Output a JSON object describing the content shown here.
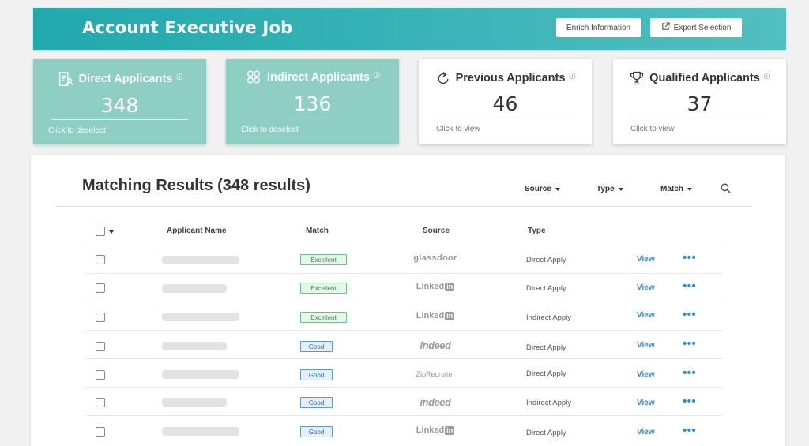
{
  "header": {
    "title": "Account Executive Job",
    "enrich_label": "Enrich Information",
    "export_label": "Export Selection"
  },
  "stats": [
    {
      "label": "Direct Applicants",
      "value": "348",
      "sub": "Click to deselect",
      "icon": "resume-icon",
      "style": "selected"
    },
    {
      "label": "Indirect Applicants",
      "value": "136",
      "sub": "Click to deselect",
      "icon": "group-icon",
      "style": "selected"
    },
    {
      "label": "Previous Applicants",
      "value": "46",
      "sub": "Click to view",
      "icon": "refresh-icon",
      "style": "default"
    },
    {
      "label": "Qualified Applicants",
      "value": "37",
      "sub": "Click to view",
      "icon": "trophy-icon",
      "style": "default"
    }
  ],
  "info_glyph": "ⓘ",
  "results": {
    "title": "Matching Results (348 results)",
    "filters": {
      "source": "Source",
      "type": "Type",
      "match": "Match"
    },
    "columns": {
      "name": "Applicant Name",
      "match": "Match",
      "source": "Source",
      "type": "Type"
    },
    "rows": [
      {
        "match": "Excellent",
        "source": "glassdoor",
        "type": "Direct Apply",
        "action": "View"
      },
      {
        "match": "Excellent",
        "source": "LinkedIn",
        "type": "Direct Apply",
        "action": "View"
      },
      {
        "match": "Excellent",
        "source": "LinkedIn",
        "type": "Indirect Apply",
        "action": "View"
      },
      {
        "match": "Good",
        "source": "indeed",
        "type": "Direct Apply",
        "action": "View"
      },
      {
        "match": "Good",
        "source": "ZipRecruiter",
        "type": "Direct Apply",
        "action": "View"
      },
      {
        "match": "Good",
        "source": "indeed",
        "type": "Indirect Apply",
        "action": "View"
      },
      {
        "match": "Good",
        "source": "LinkedIn",
        "type": "Direct Apply",
        "action": "View"
      }
    ],
    "more_glyph": "•••"
  },
  "colors": {
    "header_teal": "#21a9ad",
    "card_teal": "#8fcfc3",
    "link_blue": "#2a8ed1",
    "excellent_green": "#6fc286",
    "good_blue": "#5d99cf"
  }
}
